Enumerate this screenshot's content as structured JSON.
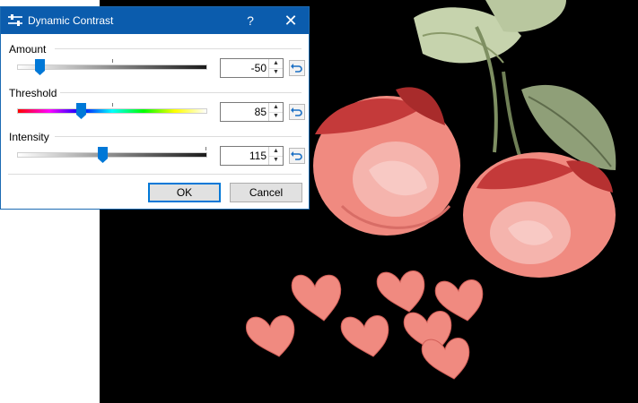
{
  "dialog": {
    "title": "Dynamic Contrast",
    "help_label": "?",
    "close_label": "✕",
    "sliders": [
      {
        "label": "Amount",
        "value": "-50"
      },
      {
        "label": "Threshold",
        "value": "85"
      },
      {
        "label": "Intensity",
        "value": "115"
      }
    ],
    "ok_label": "OK",
    "cancel_label": "Cancel"
  },
  "icons": {
    "app": "sliders-icon",
    "spin_up": "▲",
    "spin_down": "▼",
    "reset": "undo-arrow-icon"
  },
  "colors": {
    "titlebar": "#0b5cad",
    "accent": "#0078d7"
  }
}
